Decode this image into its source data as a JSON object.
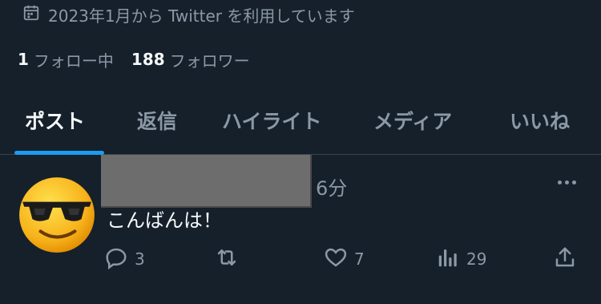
{
  "profile": {
    "joined_text": "2023年1月から Twitter を利用しています",
    "following_count": "1",
    "following_label": "フォロー中",
    "followers_count": "188",
    "followers_label": "フォロワー"
  },
  "tabs": [
    {
      "label": "ポスト",
      "active": true
    },
    {
      "label": "返信",
      "active": false
    },
    {
      "label": "ハイライト",
      "active": false
    },
    {
      "label": "メディア",
      "active": false
    },
    {
      "label": "いいね",
      "active": false
    }
  ],
  "tweet": {
    "time": "6分",
    "text": "こんばんは！",
    "replies": "3",
    "retweets": "",
    "likes": "7",
    "views": "29"
  },
  "colors": {
    "background": "#15202b",
    "accent": "#1d9bf0",
    "muted": "#8b98a5",
    "text": "#f7f9f9"
  },
  "icons": [
    "calendar-icon",
    "reply-icon",
    "retweet-icon",
    "like-icon",
    "views-icon",
    "share-icon",
    "more-icon"
  ]
}
